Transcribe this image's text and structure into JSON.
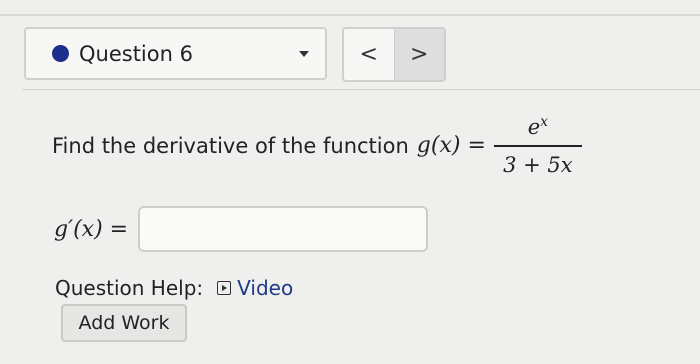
{
  "question_selector": {
    "label": "Question 6",
    "status_color": "#1c2f8c"
  },
  "nav": {
    "prev_label": "<",
    "next_label": ">"
  },
  "question": {
    "text": "Find the derivative of the function",
    "function_lhs": "g(x) =",
    "numerator_base": "e",
    "numerator_exp": "x",
    "denominator": "3 + 5x"
  },
  "answer": {
    "label": "g′(x) =",
    "value": ""
  },
  "help": {
    "label": "Question Help:",
    "video_label": "Video"
  },
  "add_work": {
    "label": "Add Work"
  }
}
